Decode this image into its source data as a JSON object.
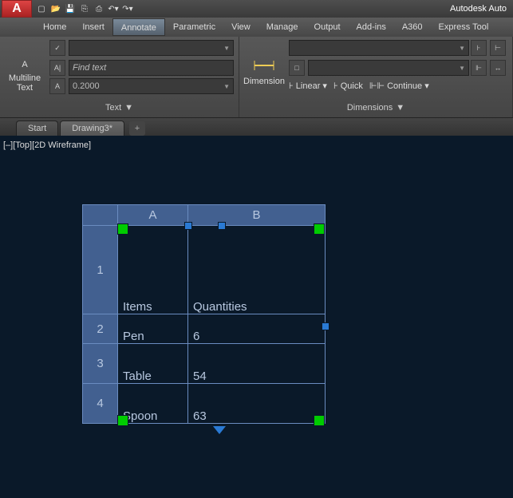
{
  "app": {
    "title": "Autodesk Auto",
    "logo": "A"
  },
  "menubar": {
    "home": "Home",
    "insert": "Insert",
    "annotate": "Annotate",
    "parametric": "Parametric",
    "view": "View",
    "manage": "Manage",
    "output": "Output",
    "addins": "Add-ins",
    "a360": "A360",
    "express": "Express Tool"
  },
  "ribbon": {
    "text_panel": {
      "big_btn_line1": "Multiline",
      "big_btn_line2": "Text",
      "find_placeholder": "Find text",
      "height_value": "0.2000",
      "title": "Text"
    },
    "dim_panel": {
      "big_btn": "Dimension",
      "linear": "Linear",
      "quick": "Quick",
      "continue": "Continue",
      "title": "Dimensions"
    }
  },
  "tabs": {
    "start": "Start",
    "drawing": "Drawing3*"
  },
  "viewport": {
    "label": "[–][Top][2D Wireframe]"
  },
  "chart_data": {
    "type": "table",
    "columns": [
      "A",
      "B"
    ],
    "row_labels": [
      "1",
      "2",
      "3",
      "4"
    ],
    "headers": {
      "items": "Items",
      "quantities": "Quantities"
    },
    "rows": [
      {
        "item": "Pen",
        "qty": "6"
      },
      {
        "item": "Table",
        "qty": "54"
      },
      {
        "item": "Spoon",
        "qty": "63"
      }
    ]
  }
}
